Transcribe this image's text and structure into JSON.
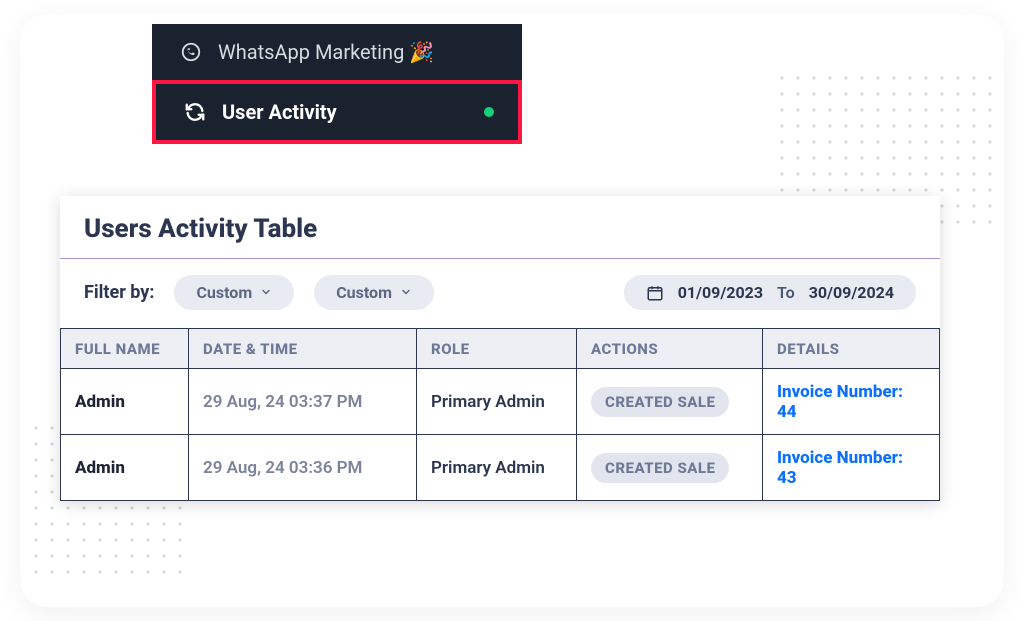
{
  "nav": {
    "items": [
      {
        "icon": "whatsapp",
        "label": "WhatsApp Marketing 🎉",
        "active": false
      },
      {
        "icon": "refresh",
        "label": "User Activity",
        "active": true
      }
    ]
  },
  "panel": {
    "title": "Users Activity Table"
  },
  "filter": {
    "label": "Filter by:",
    "selects": [
      {
        "value": "Custom"
      },
      {
        "value": "Custom"
      }
    ],
    "date_start": "01/09/2023",
    "date_to_label": "To",
    "date_end": "30/09/2024"
  },
  "table": {
    "headers": [
      "FULL NAME",
      "DATE & TIME",
      "ROLE",
      "ACTIONS",
      "DETAILS"
    ],
    "rows": [
      {
        "name": "Admin",
        "datetime": "29 Aug, 24 03:37 PM",
        "role": "Primary Admin",
        "action": "CREATED SALE",
        "detail": "Invoice Number: 44"
      },
      {
        "name": "Admin",
        "datetime": "29 Aug, 24 03:36 PM",
        "role": "Primary Admin",
        "action": "CREATED SALE",
        "detail": "Invoice Number: 43"
      }
    ]
  }
}
